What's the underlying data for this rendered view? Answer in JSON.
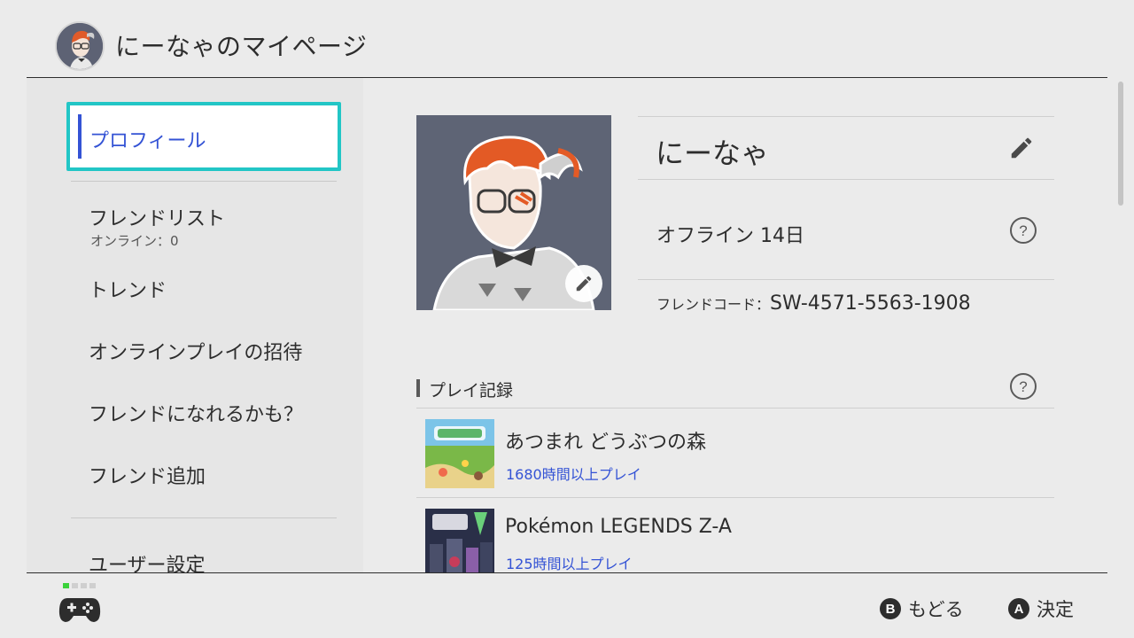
{
  "header": {
    "title": "にーなゃのマイページ"
  },
  "sidebar": {
    "items": [
      {
        "label": "プロフィール",
        "selected": true
      },
      {
        "label": "フレンドリスト",
        "sub": "オンライン：0"
      },
      {
        "label": "トレンド"
      },
      {
        "label": "オンラインプレイの招待"
      },
      {
        "label": "フレンドになれるかも？"
      },
      {
        "label": "フレンド追加"
      },
      {
        "label": "ユーザー設定"
      }
    ]
  },
  "profile": {
    "nickname": "にーなゃ",
    "status": "オフライン 14日",
    "friend_code_label": "フレンドコード",
    "friend_code_sep": "：",
    "friend_code": "SW-4571-5563-1908"
  },
  "play_records": {
    "title": "プレイ記録",
    "games": [
      {
        "title": "あつまれ どうぶつの森",
        "time": "1680時間以上プレイ"
      },
      {
        "title": "Pokémon LEGENDS Z-A",
        "time": "125時間以上プレイ"
      }
    ]
  },
  "footer": {
    "back_key": "B",
    "back_label": "もどる",
    "ok_key": "A",
    "ok_label": "決定"
  },
  "colors": {
    "accent": "#3453d5",
    "selection": "#22c6c6",
    "player_active": "#3bd23b"
  }
}
